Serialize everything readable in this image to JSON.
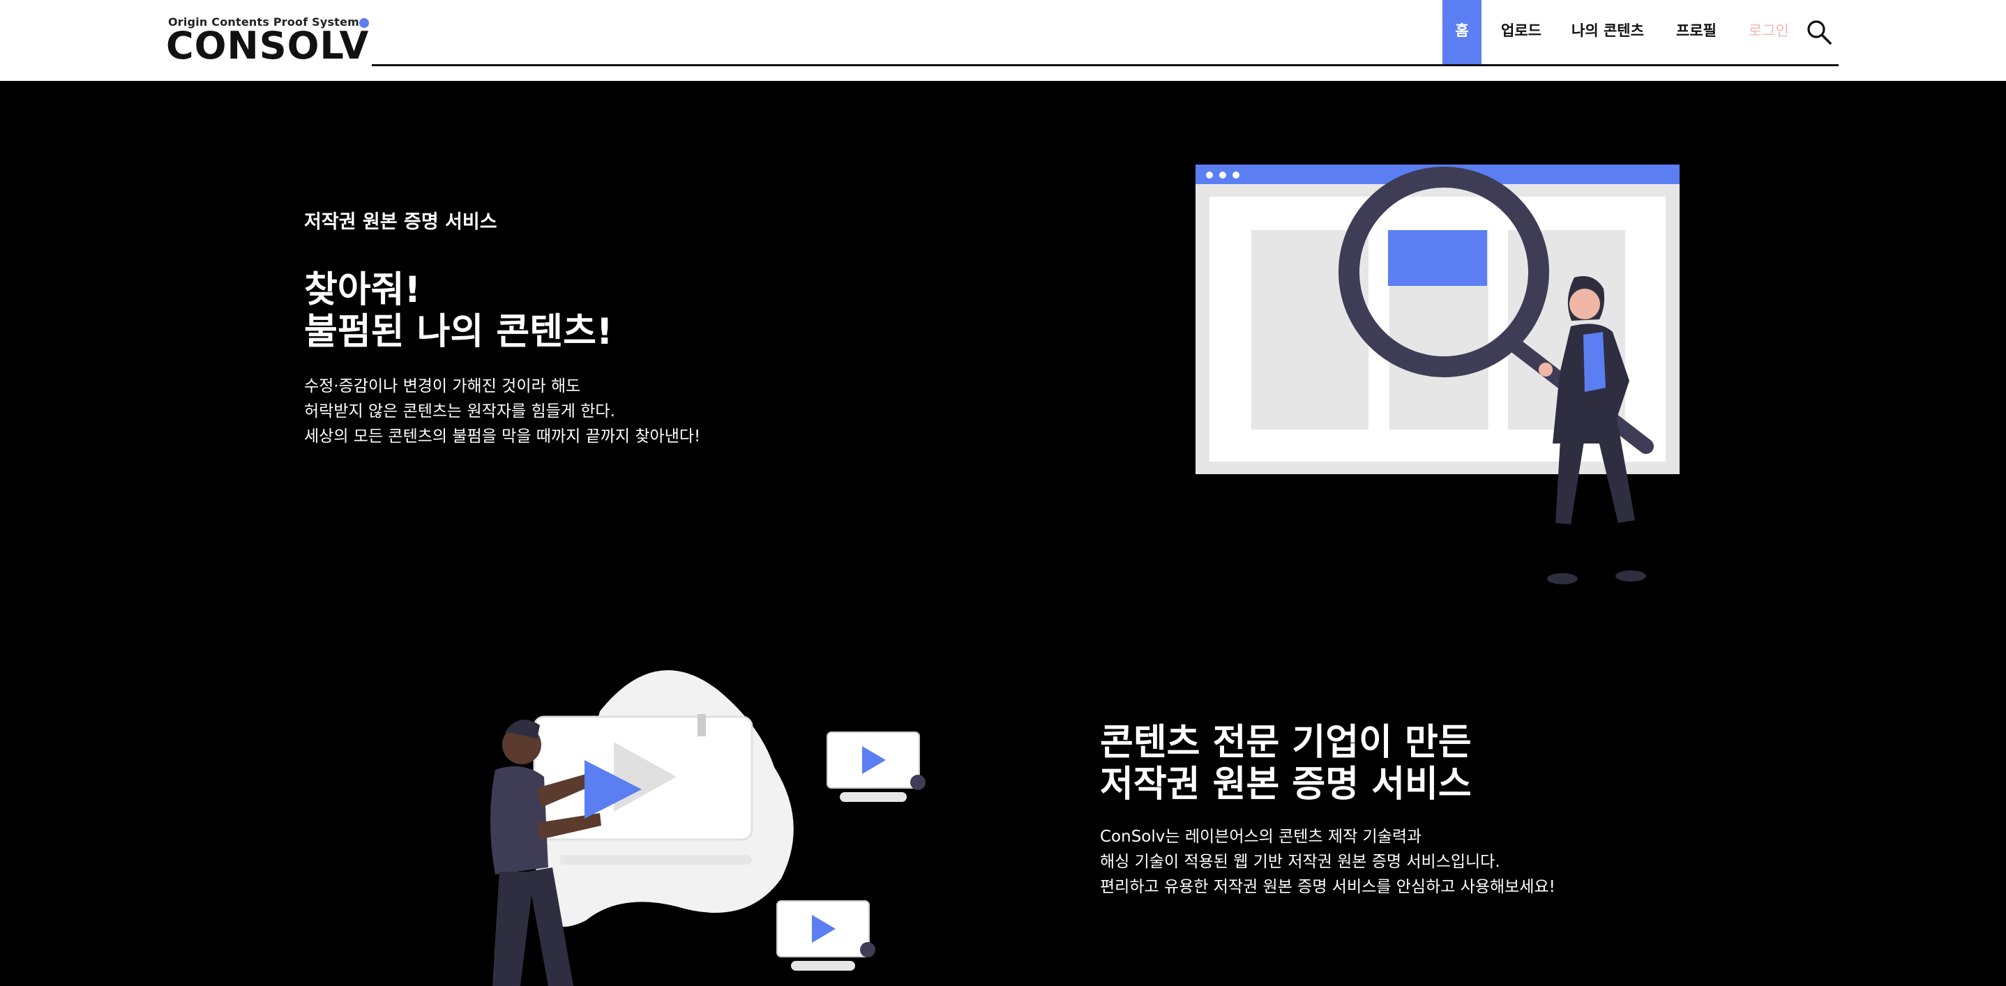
{
  "brand": {
    "tagline": "Origin Contents Proof System",
    "name": "CONSOLV",
    "accent": "#5b7ff2"
  },
  "nav": {
    "items": [
      {
        "label": "홈",
        "active": true
      },
      {
        "label": "업로드"
      },
      {
        "label": "나의 콘텐츠"
      },
      {
        "label": "프로필"
      },
      {
        "label": "로그인"
      }
    ],
    "search_icon": "search-icon"
  },
  "hero": {
    "tag": "저작권 원본 증명 서비스",
    "title_lines": [
      "찾아줘!",
      "불펌된 나의 콘텐츠!"
    ],
    "desc_lines": [
      "수정·증감이나 변경이 가해진 것이라 해도",
      "허락받지 않은 콘텐츠는 원작자를 힘들게 한다.",
      "세상의 모든 콘텐츠의 불펌을 막을 때까지 끝까지 찾아낸다!"
    ]
  },
  "feature": {
    "title_lines": [
      "콘텐츠 전문 기업이 만든",
      "저작권 원본 증명 서비스"
    ],
    "desc_lines": [
      "ConSolv는 레이븐어스의 콘텐츠 제작 기술력과",
      "해싱 기술이 적용된 웹 기반 저작권 원본 증명 서비스입니다.",
      "편리하고 유용한 저작권 원본 증명 서비스를 안심하고 사용해보세요!"
    ]
  }
}
